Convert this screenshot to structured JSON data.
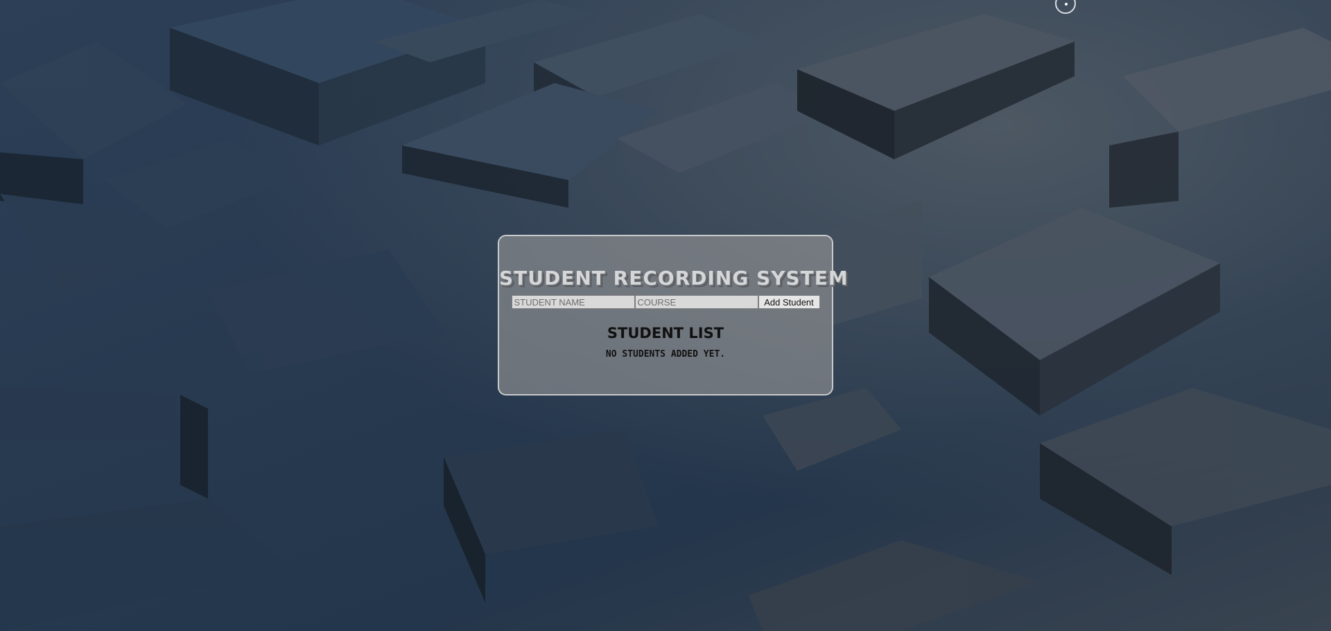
{
  "app": {
    "title": "STUDENT RECORDING SYSTEM"
  },
  "form": {
    "name_placeholder": "STUDENT NAME",
    "course_placeholder": "COURSE",
    "add_button_label": "Add Student"
  },
  "list": {
    "heading": "STUDENT LIST",
    "empty_message": "NO STUDENTS ADDED YET."
  },
  "icons": {
    "cursor": "cursor-ring-icon"
  },
  "colors": {
    "panel_bg": "#969696",
    "panel_border": "#c8cacc",
    "title_text": "#d4d6d8",
    "background": "#2a3848"
  }
}
